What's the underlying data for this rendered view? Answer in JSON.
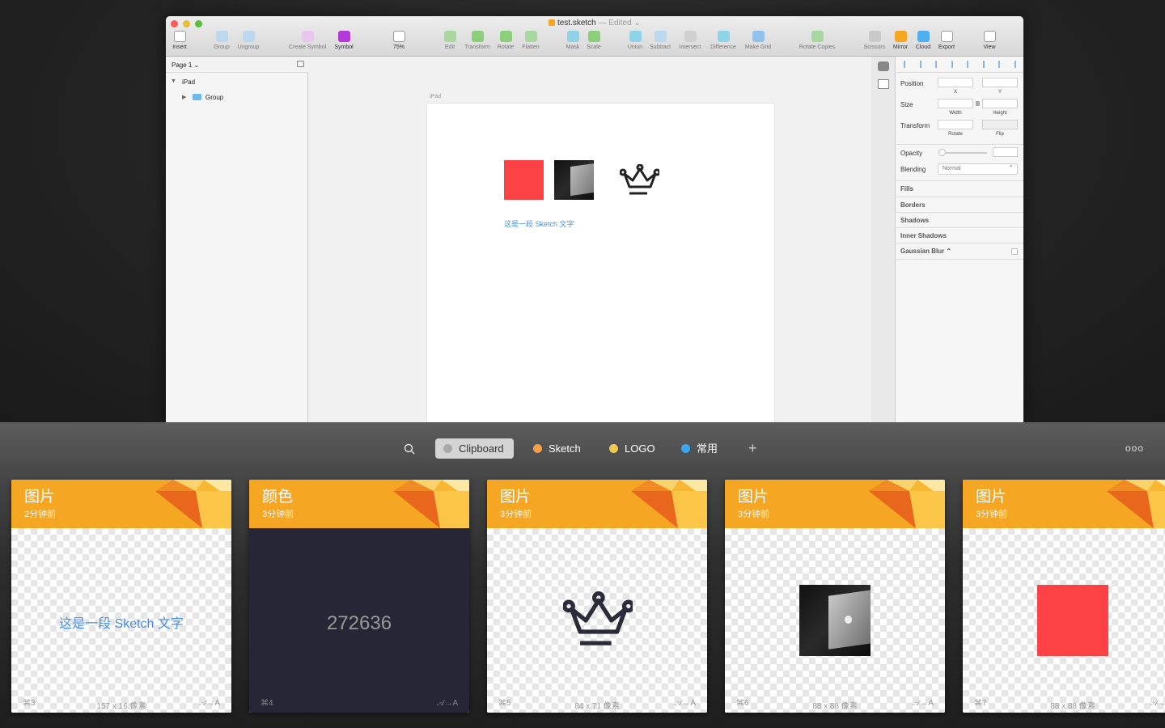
{
  "window": {
    "filename": "test.sketch",
    "edited": "— Edited ⌄",
    "toolbar": [
      {
        "label": "Insert",
        "icon": "plus-icon"
      },
      {
        "label": "Group",
        "icon": "group-icon"
      },
      {
        "label": "Ungroup",
        "icon": "ungroup-icon"
      },
      {
        "label": "Create Symbol",
        "icon": "create-symbol-icon"
      },
      {
        "label": "Symbol",
        "icon": "symbol-icon"
      },
      {
        "label": "75%",
        "icon": "zoom-icon"
      },
      {
        "label": "Edit",
        "icon": "edit-icon"
      },
      {
        "label": "Transform",
        "icon": "transform-icon"
      },
      {
        "label": "Rotate",
        "icon": "rotate-icon"
      },
      {
        "label": "Flatten",
        "icon": "flatten-icon"
      },
      {
        "label": "Mask",
        "icon": "mask-icon"
      },
      {
        "label": "Scale",
        "icon": "scale-icon"
      },
      {
        "label": "Union",
        "icon": "union-icon"
      },
      {
        "label": "Subtract",
        "icon": "subtract-icon"
      },
      {
        "label": "Intersect",
        "icon": "intersect-icon"
      },
      {
        "label": "Difference",
        "icon": "difference-icon"
      },
      {
        "label": "Make Grid",
        "icon": "make-grid-icon"
      },
      {
        "label": "Rotate Copies",
        "icon": "rotate-copies-icon"
      },
      {
        "label": "Scissors",
        "icon": "scissors-icon"
      },
      {
        "label": "Mirror",
        "icon": "mirror-icon"
      },
      {
        "label": "Cloud",
        "icon": "cloud-icon"
      },
      {
        "label": "Export",
        "icon": "export-icon"
      },
      {
        "label": "View",
        "icon": "view-icon"
      }
    ],
    "layers": {
      "page": "Page 1 ⌄",
      "artboard": "iPad",
      "group": "Group"
    },
    "canvas": {
      "artboard_label": "iPad",
      "text_layer": "这是一段 Sketch 文字"
    },
    "inspector": {
      "position": "Position",
      "x": "X",
      "y": "Y",
      "size": "Size",
      "width": "Width",
      "height": "Height",
      "transform": "Transform",
      "rotate": "Rotate",
      "flip": "Flip",
      "opacity": "Opacity",
      "blending": "Blending",
      "blending_value": "Normal",
      "fills": "Fills",
      "borders": "Borders",
      "shadows": "Shadows",
      "inner_shadows": "Inner Shadows",
      "gaussian_blur": "Gaussian Blur ⌃"
    }
  },
  "panel": {
    "tabs": [
      {
        "label": "Clipboard",
        "color": "#a9a9a9",
        "selected": true
      },
      {
        "label": "Sketch",
        "color": "#f5a043"
      },
      {
        "label": "LOGO",
        "color": "#f2c94c"
      },
      {
        "label": "常用",
        "color": "#3ea6f0"
      }
    ],
    "more": "ooo",
    "add": "+",
    "cards": [
      {
        "type": "图片",
        "time": "2分钟前",
        "shortcut": "⌘3",
        "dims": "157 x 16 像素",
        "action": "𝒜→A",
        "preview": "text",
        "preview_text": "这是一段 Sketch 文字"
      },
      {
        "type": "颜色",
        "time": "3分钟前",
        "shortcut": "⌘4",
        "dims": "",
        "action": "𝒜→A",
        "preview": "color",
        "preview_text": "272636",
        "color": "#272636"
      },
      {
        "type": "图片",
        "time": "3分钟前",
        "shortcut": "⌘5",
        "dims": "84 x 71 像素",
        "action": "𝒜→A",
        "preview": "crown"
      },
      {
        "type": "图片",
        "time": "3分钟前",
        "shortcut": "⌘6",
        "dims": "88 x 88 像素",
        "action": "𝒜→A",
        "preview": "laptop"
      },
      {
        "type": "图片",
        "time": "3分钟前",
        "shortcut": "⌘7",
        "dims": "88 x 88 像素",
        "action": "𝒜→A",
        "preview": "red"
      }
    ]
  },
  "colors": {
    "accent": "#f5a623",
    "red": "#fc4245",
    "text_blue": "#4a90e2"
  }
}
